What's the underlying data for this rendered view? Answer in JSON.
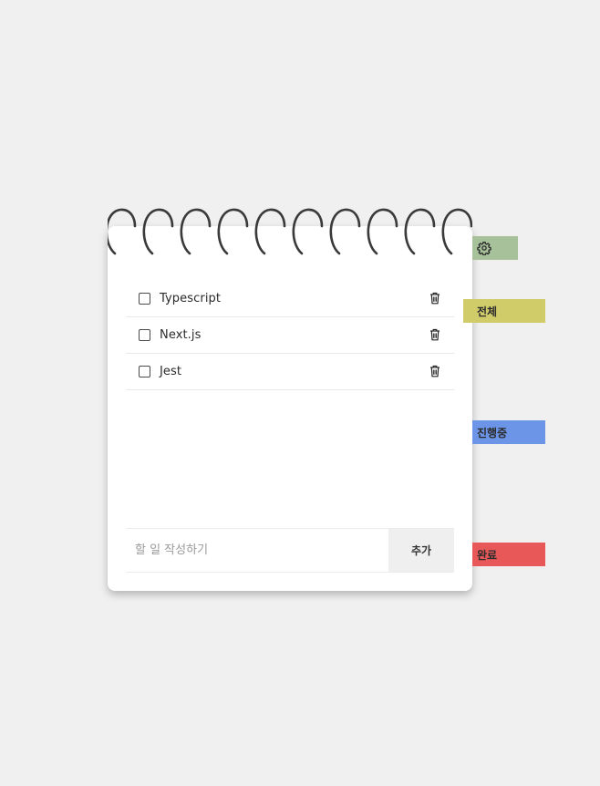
{
  "todos": [
    {
      "text": "Typescript",
      "checked": false
    },
    {
      "text": "Next.js",
      "checked": false
    },
    {
      "text": "Jest",
      "checked": false
    }
  ],
  "input": {
    "placeholder": "할 일 작성하기",
    "value": ""
  },
  "add_button_label": "추가",
  "tabs": {
    "settings": {
      "icon": "gear-icon",
      "color": "#a7c29a"
    },
    "all": {
      "label": "전체",
      "color": "#d1cc6a"
    },
    "in_progress": {
      "label": "진행중",
      "color": "#6c95e8"
    },
    "done": {
      "label": "완료",
      "color": "#e85858"
    }
  }
}
